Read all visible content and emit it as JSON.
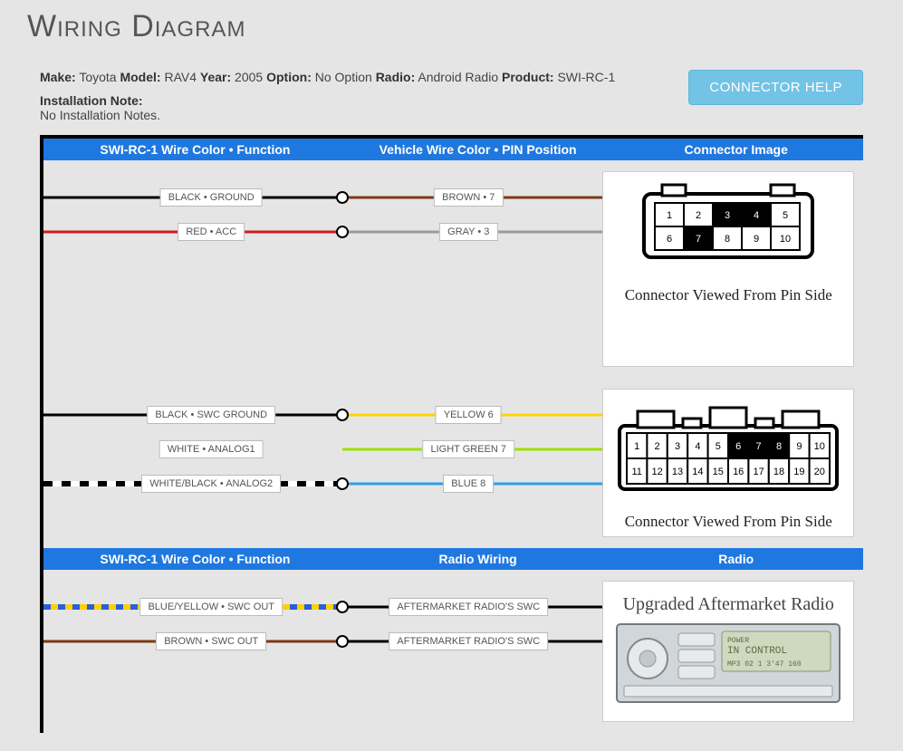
{
  "title": "Wiring Diagram",
  "meta": {
    "make_label": "Make:",
    "make": "Toyota",
    "model_label": "Model:",
    "model": "RAV4",
    "year_label": "Year:",
    "year": "2005",
    "option_label": "Option:",
    "option": "No Option",
    "radio_label": "Radio:",
    "radio": "Android Radio",
    "product_label": "Product:",
    "product": "SWI-RC-1",
    "note_label": "Installation Note:",
    "note": "No Installation Notes."
  },
  "buttons": {
    "connector_help": "CONNECTOR HELP"
  },
  "headers": {
    "left": "SWI-RC-1 Wire Color • Function",
    "mid_vehicle": "Vehicle Wire Color • PIN Position",
    "mid_radio": "Radio Wiring",
    "right_conn": "Connector Image",
    "right_radio": "Radio"
  },
  "connectors": {
    "caption": "Connector Viewed From Pin Side",
    "upgraded_caption": "Upgraded Aftermarket Radio",
    "radio_screen_l1": "POWER",
    "radio_screen_l2": "IN CONTROL",
    "radio_screen_l3": "MP3  02  1  3'47  160",
    "c1_pins": [
      "1",
      "2",
      "3",
      "4",
      "5",
      "6",
      "7",
      "8",
      "9",
      "10"
    ],
    "c1_highlight": [
      "3",
      "4",
      "7"
    ],
    "c2_pins": [
      "1",
      "2",
      "3",
      "4",
      "5",
      "6",
      "7",
      "8",
      "9",
      "10",
      "11",
      "12",
      "13",
      "14",
      "15",
      "16",
      "17",
      "18",
      "19",
      "20"
    ],
    "c2_highlight": [
      "6",
      "7",
      "8"
    ]
  },
  "sections": [
    {
      "rows": [
        {
          "left_label": "BLACK • GROUND",
          "left_color": "#000000",
          "right_label": "BROWN • 7",
          "right_color": "#7a3b12",
          "node": true
        },
        {
          "left_label": "RED • ACC",
          "left_color": "#d11a1a",
          "right_label": "GRAY • 3",
          "right_color": "#9a9a9a",
          "node": true
        }
      ]
    },
    {
      "rows": [
        {
          "left_label": "BLACK • SWC GROUND",
          "left_color": "#000000",
          "right_label": "YELLOW 6",
          "right_color": "#ffd400",
          "node": true
        },
        {
          "left_label": "WHITE • ANALOG1",
          "left_color": "#ffffff",
          "right_label": "LIGHT GREEN 7",
          "right_color": "#9be000",
          "node": false,
          "left_hidden": true
        },
        {
          "left_label": "WHITE/BLACK • ANALOG2",
          "left_dash": "bw",
          "right_label": "BLUE 8",
          "right_color": "#2f9fe6",
          "node": true
        }
      ]
    },
    {
      "rows": [
        {
          "left_label": "BLUE/YELLOW • SWC OUT",
          "left_dash": "by",
          "right_label": "AFTERMARKET RADIO'S SWC",
          "right_color": "#000000",
          "node": true
        },
        {
          "left_label": "BROWN • SWC OUT",
          "left_color": "#7a3b12",
          "right_label": "AFTERMARKET RADIO'S SWC",
          "right_color": "#000000",
          "node": true
        }
      ]
    }
  ]
}
